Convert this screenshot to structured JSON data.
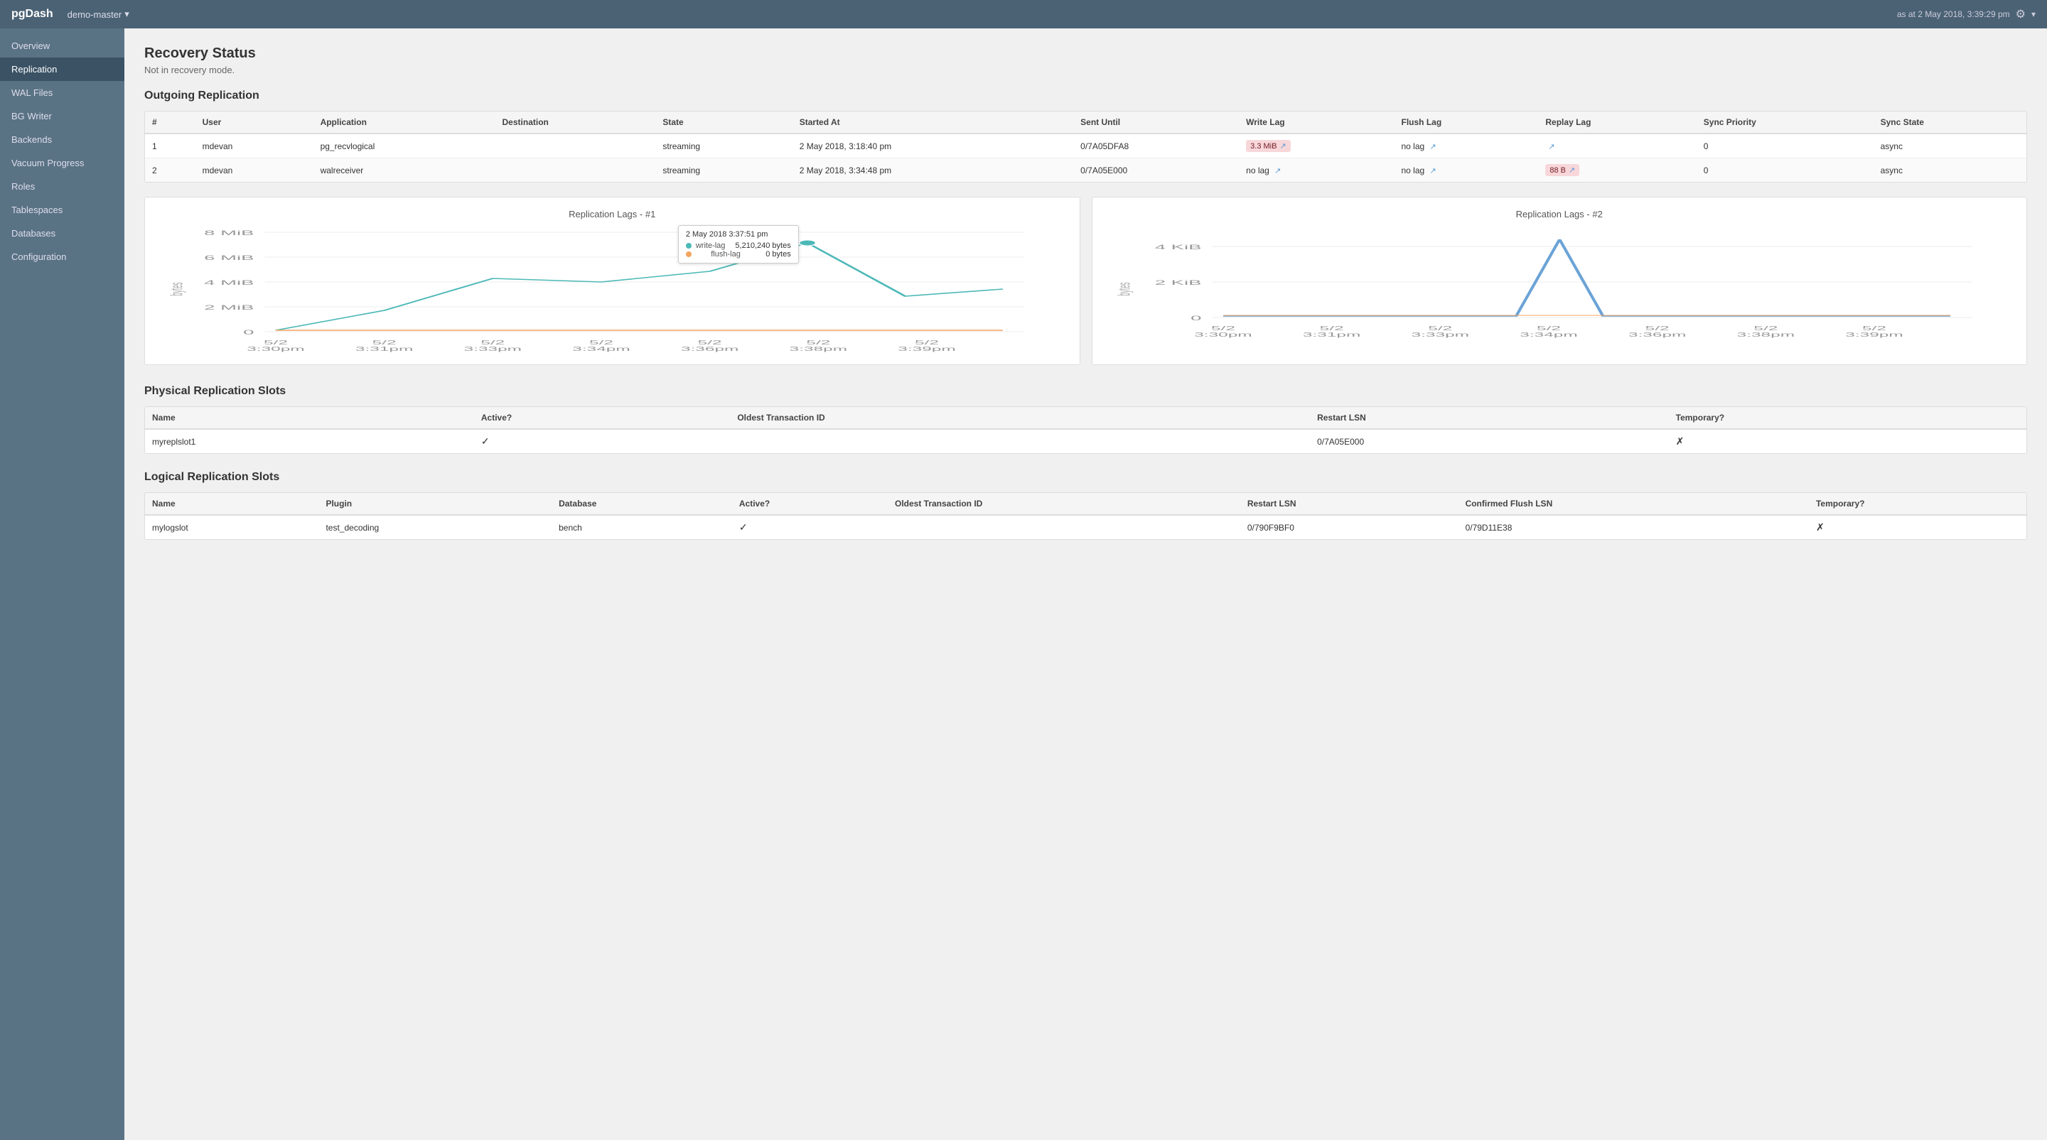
{
  "header": {
    "brand": "pgDash",
    "db": "demo-master",
    "timestamp": "as at 2 May 2018, 3:39:29 pm"
  },
  "sidebar": {
    "items": [
      {
        "label": "Overview",
        "active": false
      },
      {
        "label": "Replication",
        "active": true
      },
      {
        "label": "WAL Files",
        "active": false
      },
      {
        "label": "BG Writer",
        "active": false
      },
      {
        "label": "Backends",
        "active": false
      },
      {
        "label": "Vacuum Progress",
        "active": false
      },
      {
        "label": "Roles",
        "active": false
      },
      {
        "label": "Tablespaces",
        "active": false
      },
      {
        "label": "Databases",
        "active": false
      },
      {
        "label": "Configuration",
        "active": false
      }
    ]
  },
  "recovery_status": {
    "title": "Recovery Status",
    "subtitle": "Not in recovery mode."
  },
  "outgoing_replication": {
    "title": "Outgoing Replication",
    "columns": [
      "#",
      "User",
      "Application",
      "Destination",
      "State",
      "Started At",
      "Sent Until",
      "Write Lag",
      "Flush Lag",
      "Replay Lag",
      "Sync Priority",
      "Sync State"
    ],
    "rows": [
      {
        "num": "1",
        "user": "mdevan",
        "application": "pg_recvlogical",
        "destination": "",
        "state": "streaming",
        "started_at": "2 May 2018, 3:18:40 pm",
        "sent_until": "0/7A05DFA8",
        "write_lag": "3.3 MiB",
        "write_lag_highlight": true,
        "flush_lag": "no lag",
        "flush_lag_highlight": false,
        "replay_lag": "",
        "replay_lag_highlight": false,
        "sync_priority": "0",
        "sync_state": "async"
      },
      {
        "num": "2",
        "user": "mdevan",
        "application": "walreceiver",
        "destination": "",
        "state": "streaming",
        "started_at": "2 May 2018, 3:34:48 pm",
        "sent_until": "0/7A05E000",
        "write_lag": "no lag",
        "write_lag_highlight": false,
        "flush_lag": "no lag",
        "flush_lag_highlight": false,
        "replay_lag": "88 B",
        "replay_lag_highlight": true,
        "sync_priority": "0",
        "sync_state": "async"
      }
    ]
  },
  "chart1": {
    "title": "Replication Lags - #1",
    "tooltip": {
      "time": "2 May 2018 3:37:51 pm",
      "rows": [
        {
          "label": "write-lag",
          "value": "5,210,240 bytes",
          "color": "#4db8b8"
        },
        {
          "label": "flush-lag",
          "value": "0 bytes",
          "color": "#f4a460"
        }
      ]
    },
    "y_labels": [
      "8\nMiB",
      "6\nMiB",
      "4\nMiB",
      "2\nMiB",
      "0"
    ],
    "x_labels": [
      "5/2\n3:30pm",
      "5/2\n3:31pm",
      "5/2\n3:33pm",
      "5/2\n3:34pm",
      "5/2\n3:36pm",
      "5/2\n3:38pm",
      "5/2\n3:39pm"
    ],
    "y_axis_label": "bytes"
  },
  "chart2": {
    "title": "Replication Lags - #2",
    "y_labels": [
      "4\nKiB",
      "2\nKiB",
      "0"
    ],
    "x_labels": [
      "5/2\n3:30pm",
      "5/2\n3:31pm",
      "5/2\n3:33pm",
      "5/2\n3:34pm",
      "5/2\n3:36pm",
      "5/2\n3:38pm",
      "5/2\n3:39pm"
    ],
    "y_axis_label": "bytes"
  },
  "physical_slots": {
    "title": "Physical Replication Slots",
    "columns": [
      "Name",
      "Active?",
      "Oldest Transaction ID",
      "Restart LSN",
      "Temporary?"
    ],
    "rows": [
      {
        "name": "myreplslot1",
        "active": true,
        "oldest_txid": "",
        "restart_lsn": "0/7A05E000",
        "temporary": false
      }
    ]
  },
  "logical_slots": {
    "title": "Logical Replication Slots",
    "columns": [
      "Name",
      "Plugin",
      "Database",
      "Active?",
      "Oldest Transaction ID",
      "Restart LSN",
      "Confirmed Flush LSN",
      "Temporary?"
    ],
    "rows": [
      {
        "name": "mylogslot",
        "plugin": "test_decoding",
        "database": "bench",
        "active": true,
        "oldest_txid": "",
        "restart_lsn": "0/790F9BF0",
        "confirmed_flush_lsn": "0/79D11E38",
        "temporary": false
      }
    ]
  }
}
